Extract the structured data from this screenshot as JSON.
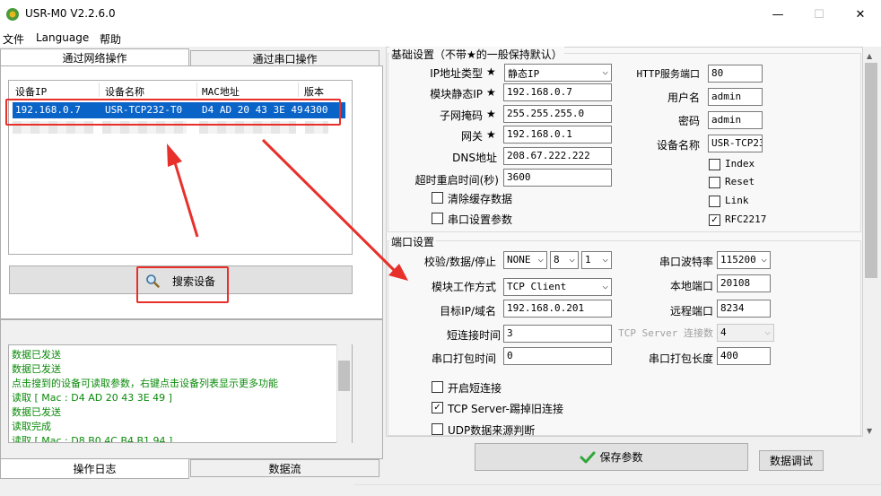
{
  "window": {
    "title": "USR-M0 V2.2.6.0",
    "minimize": "—",
    "maximize": "☐",
    "close": "✕"
  },
  "menu": [
    "文件",
    "Language",
    "帮助"
  ],
  "left_tabs": [
    "通过网络操作",
    "通过串口操作"
  ],
  "device_table": {
    "columns": [
      "设备IP",
      "设备名称",
      "MAC地址",
      "版本"
    ],
    "rows": [
      {
        "ip": "192.168.0.7",
        "name": "USR-TCP232-T0",
        "mac": "D4 AD 20 43 3E 49",
        "version": "4300"
      }
    ]
  },
  "search_button": "搜索设备",
  "log": {
    "lines": [
      "数据已发送",
      "数据已发送",
      "点击搜到的设备可读取参数，右键点击设备列表显示更多功能",
      "读取 [ Mac : D4 AD 20 43 3E 49 ]",
      "数据已发送",
      "读取完成",
      "读取 [ Mac : D8 B0 4C B4 B1 94 ]"
    ],
    "tabs": [
      "操作日志",
      "数据流"
    ]
  },
  "basic": {
    "title": "基础设置（不带★的一般保持默认）",
    "star": "★",
    "ip_type_label": "IP地址类型",
    "ip_type": "静态IP",
    "static_ip_label": "模块静态IP",
    "static_ip": "192.168.0.7",
    "mask_label": "子网掩码",
    "mask": "255.255.255.0",
    "gateway_label": "网关",
    "gateway": "192.168.0.1",
    "dns_label": "DNS地址",
    "dns": "208.67.222.222",
    "timeout_label": "超时重启时间(秒)",
    "timeout": "3600",
    "clear_cache": "清除缓存数据",
    "serial_params": "串口设置参数",
    "http_port_label": "HTTP服务端口",
    "http_port": "80",
    "username_label": "用户名",
    "username": "admin",
    "password_label": "密码",
    "password": "admin",
    "device_name_label": "设备名称",
    "device_name": "USR-TCP23",
    "checks": [
      {
        "label": "Index",
        "checked": false
      },
      {
        "label": "Reset",
        "checked": false
      },
      {
        "label": "Link",
        "checked": false
      },
      {
        "label": "RFC2217",
        "checked": true
      }
    ]
  },
  "port": {
    "title": "端口设置",
    "parity_label": "校验/数据/停止",
    "parity": "NONE",
    "data_bits": "8",
    "stop_bits": "1",
    "mode_label": "模块工作方式",
    "mode": "TCP Client",
    "target_label": "目标IP/域名",
    "target": "192.168.0.201",
    "short_conn_label": "短连接时间",
    "short_conn": "3",
    "pack_time_label": "串口打包时间",
    "pack_time": "0",
    "baud_label": "串口波特率",
    "baud": "115200",
    "local_port_label": "本地端口",
    "local_port": "20108",
    "remote_port_label": "远程端口",
    "remote_port": "8234",
    "tcp_server_conn_label": "TCP Server 连接数",
    "tcp_server_conn": "4",
    "pack_len_label": "串口打包长度",
    "pack_len": "400",
    "check_short": "开启短连接",
    "check_kick": "TCP Server-踢掉旧连接",
    "check_udp": "UDP数据来源判断",
    "check_kick_checked": true
  },
  "save_button": "保存参数",
  "debug_button": "数据调试",
  "colors": {
    "selection": "#0a64c8",
    "annotation": "#e8302b",
    "log_text": "#0a8a0a",
    "save_check": "#2fa83a"
  }
}
